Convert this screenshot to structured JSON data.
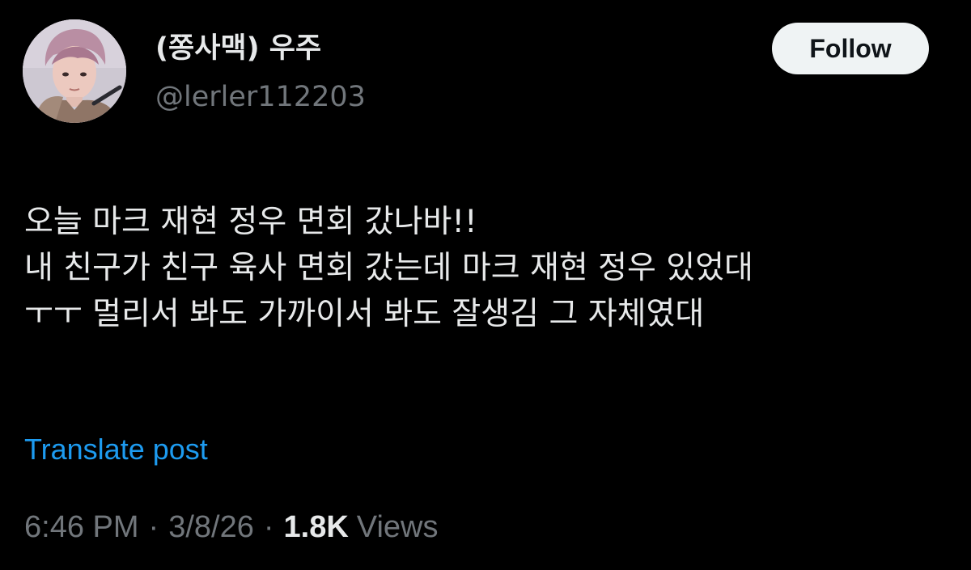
{
  "user": {
    "display_name": "(쫑사맥) 우주",
    "handle": "@lerler112203"
  },
  "actions": {
    "follow_label": "Follow"
  },
  "post": {
    "lines": [
      "오늘 마크 재현 정우 면회 갔나바!!",
      "내 친구가 친구 육사 면회 갔는데 마크 재현 정우 있었대",
      "ㅜㅜ 멀리서 봐도 가까이서 봐도 잘생김 그 자체였대"
    ],
    "translate_label": "Translate post"
  },
  "meta": {
    "time": "6:46 PM",
    "separator": "·",
    "date": "3/8/26",
    "views_count": "1.8K",
    "views_label": "Views"
  },
  "colors": {
    "background": "#000000",
    "primary_text": "#e7e9ea",
    "secondary_text": "#71767b",
    "link": "#1d9bf0",
    "follow_button_bg": "#eff3f4"
  }
}
